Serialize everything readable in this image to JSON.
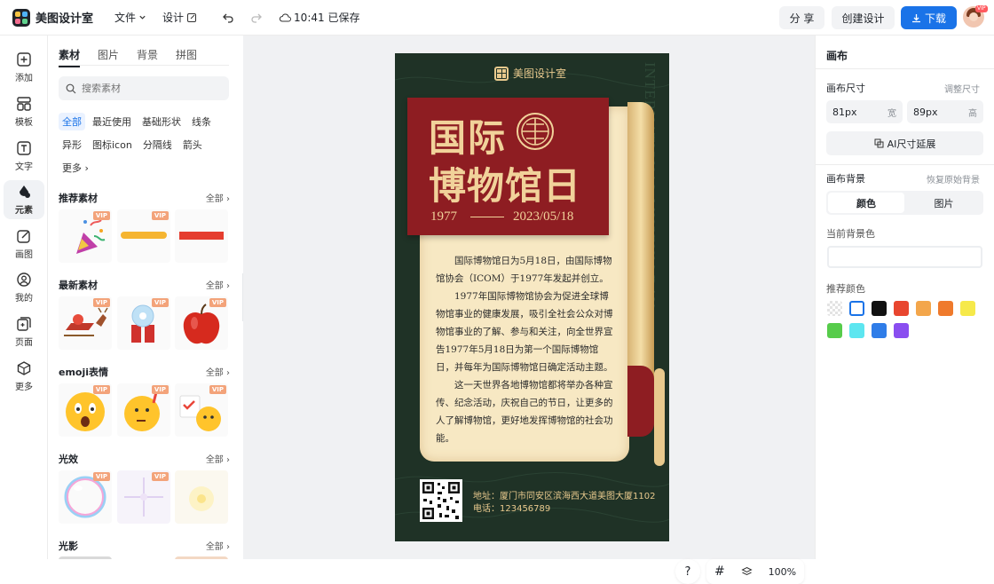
{
  "app": {
    "logo_text": "美图设计室"
  },
  "topbar": {
    "file_menu": "文件",
    "design_menu": "设计",
    "save_status": "10:41 已保存",
    "share_label": "分 享",
    "create_label": "创建设计",
    "download_label": "下载",
    "avatar_badge": "VIP"
  },
  "leftnav": {
    "items": [
      {
        "label": "添加",
        "icon": "plus-square-icon"
      },
      {
        "label": "模板",
        "icon": "template-icon"
      },
      {
        "label": "文字",
        "icon": "text-icon"
      },
      {
        "label": "元素",
        "icon": "shapes-icon"
      },
      {
        "label": "画图",
        "icon": "draw-icon"
      },
      {
        "label": "我的",
        "icon": "user-icon"
      },
      {
        "label": "页面",
        "icon": "page-icon"
      },
      {
        "label": "更多",
        "icon": "cube-icon"
      }
    ]
  },
  "panel": {
    "tabs": [
      "素材",
      "图片",
      "背景",
      "拼图"
    ],
    "search_placeholder": "搜索素材",
    "chips": [
      "全部",
      "最近使用",
      "基础形状",
      "线条",
      "异形",
      "图标icon",
      "分隔线",
      "箭头",
      "更多"
    ],
    "all_label": "全部",
    "sections": [
      {
        "title": "推荐素材"
      },
      {
        "title": "最新素材"
      },
      {
        "title": "emoji表情"
      },
      {
        "title": "光效"
      },
      {
        "title": "光影"
      }
    ],
    "vip": "VIP"
  },
  "poster": {
    "brand": "美图设计室",
    "title_line1": "国际",
    "title_line2": "博物馆日",
    "year": "1977",
    "date": "2023/05/18",
    "side_text": "INTERNATIONAL MUSEUM DAY",
    "para1": "国际博物馆日为5月18日，由国际博物馆协会（ICOM）于1977年发起并创立。",
    "para2": "1977年国际博物馆协会为促进全球博物馆事业的健康发展，吸引全社会公众对博物馆事业的了解、参与和关注，向全世界宣告1977年5月18日为第一个国际博物馆日，并每年为国际博物馆日确定活动主题。",
    "para3": "这一天世界各地博物馆都将举办各种宣传、纪念活动，庆祝自己的节日，让更多的人了解博物馆，更好地发挥博物馆的社会功能。",
    "address": "地址：厦门市同安区滨海西大道美图大厦1102",
    "phone": "电话：123456789"
  },
  "right": {
    "title": "画布",
    "size_label": "画布尺寸",
    "resize_label": "调整尺寸",
    "width_value": "81px",
    "width_unit": "宽",
    "height_value": "89px",
    "height_unit": "高",
    "ai_extend": "AI尺寸延展",
    "bg_label": "画布背景",
    "restore_bg": "恢复原始背景",
    "bg_tab_color": "颜色",
    "bg_tab_image": "图片",
    "current_bg": "当前背景色",
    "recommended": "推荐颜色",
    "colors": [
      "transparent",
      "#ffffff",
      "#111111",
      "#e8462f",
      "#f3a64b",
      "#ef7a2c",
      "#f6e94a",
      "#57cc4b",
      "#5de6f0",
      "#2f7de8",
      "#8a4ef0"
    ]
  },
  "bottom": {
    "help": "?",
    "zoom": "100%"
  },
  "colors": {
    "accent": "#1a73e8",
    "poster_bg": "#1f3226",
    "poster_red": "#8e1d22",
    "poster_gold": "#e8c98d"
  }
}
